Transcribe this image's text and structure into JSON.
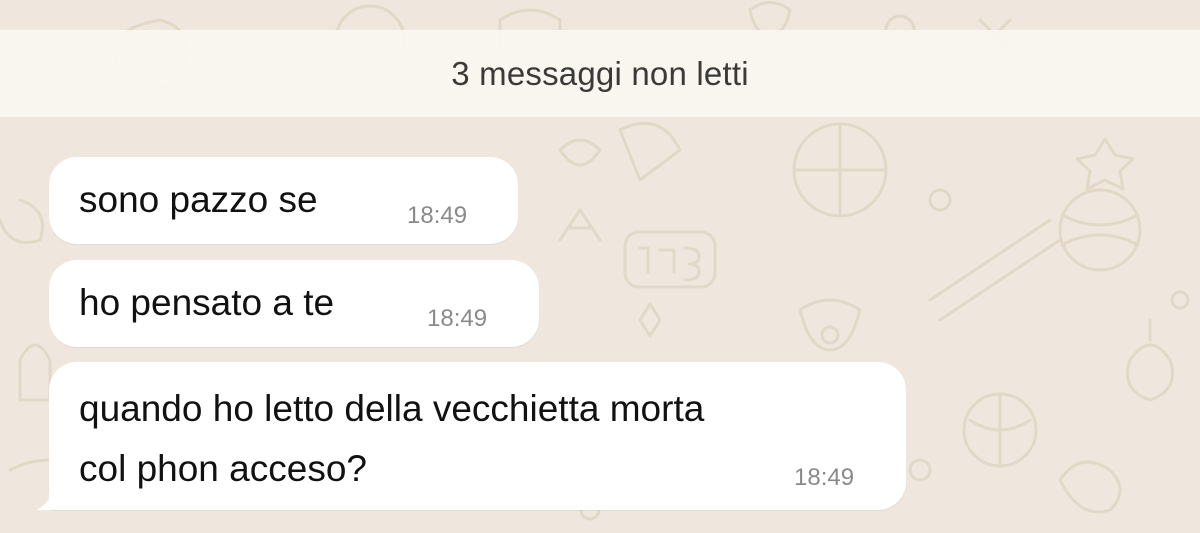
{
  "chat": {
    "unread_banner": "3 messaggi non letti",
    "messages": [
      {
        "text": "sono pazzo se",
        "time": "18:49"
      },
      {
        "text": "ho pensato a te",
        "time": "18:49"
      },
      {
        "lines": [
          "quando ho letto della vecchietta morta",
          "col phon acceso?"
        ],
        "time": "18:49"
      }
    ]
  },
  "colors": {
    "wallpaper": "#efe7dd",
    "bubble": "#ffffff",
    "doodle": "#e2d8c8"
  }
}
